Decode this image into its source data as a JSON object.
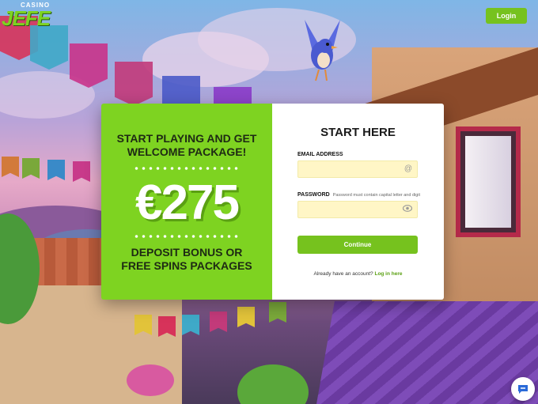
{
  "brand": {
    "small": "CASINO",
    "big": "JEFE"
  },
  "header": {
    "login_label": "Login"
  },
  "promo": {
    "line1": "START PLAYING AND GET",
    "line2": "WELCOME PACKAGE!",
    "amount": "€275",
    "line3": "DEPOSIT BONUS OR",
    "line4": "FREE SPINS PACKAGES"
  },
  "form": {
    "title": "START HERE",
    "email_label": "EMAIL ADDRESS",
    "email_value": "",
    "password_label": "PASSWORD",
    "password_hint": "Password must contain capital letter and digit",
    "password_value": "",
    "continue_label": "Continue",
    "account_text": "Already have an account?",
    "login_link": "Log in here"
  },
  "icons": {
    "email": "at-icon",
    "password": "eye-icon",
    "chat": "chat-icon"
  },
  "colors": {
    "accent": "#76c21e",
    "promo_bg": "#7ed321",
    "field_bg": "#fff6c6"
  }
}
